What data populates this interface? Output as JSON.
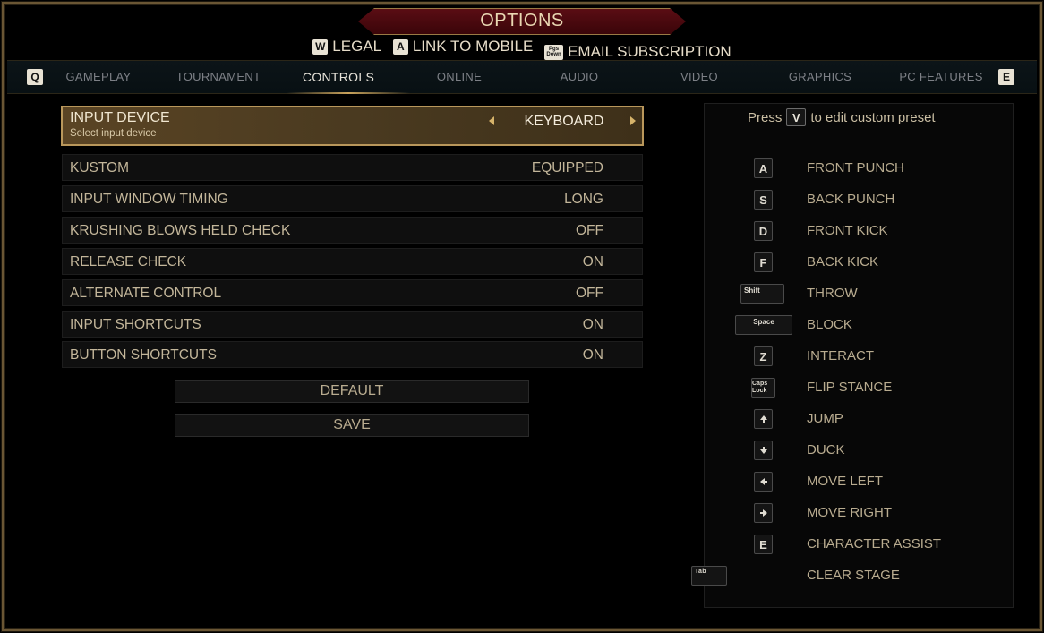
{
  "header": {
    "title": "OPTIONS",
    "subnav": [
      {
        "key": "W",
        "label": "LEGAL"
      },
      {
        "key": "A",
        "label": "LINK TO MOBILE"
      },
      {
        "key_top": "Pgs",
        "key_bottom": "Down",
        "label": "EMAIL SUBSCRIPTION"
      }
    ]
  },
  "tabs": {
    "prev_key": "Q",
    "next_key": "E",
    "items": [
      "GAMEPLAY",
      "TOURNAMENT",
      "CONTROLS",
      "ONLINE",
      "AUDIO",
      "VIDEO",
      "GRAPHICS",
      "PC FEATURES"
    ],
    "active": "CONTROLS"
  },
  "settings": {
    "input_device": {
      "label": "INPUT DEVICE",
      "sublabel": "Select input device",
      "value": "KEYBOARD"
    },
    "rows": [
      {
        "label": "KUSTOM",
        "value": "EQUIPPED"
      },
      {
        "label": "INPUT WINDOW TIMING",
        "value": "LONG"
      },
      {
        "label": "KRUSHING BLOWS HELD CHECK",
        "value": "OFF"
      },
      {
        "label": "RELEASE CHECK",
        "value": "ON"
      },
      {
        "label": "ALTERNATE CONTROL",
        "value": "OFF"
      },
      {
        "label": "INPUT SHORTCUTS",
        "value": "ON"
      },
      {
        "label": "BUTTON SHORTCUTS",
        "value": "ON"
      }
    ],
    "default_label": "DEFAULT",
    "save_label": "SAVE"
  },
  "bindings": {
    "press_prefix": "Press",
    "press_key": "V",
    "press_suffix": "to edit custom preset",
    "items": [
      {
        "key": "A",
        "action": "FRONT PUNCH"
      },
      {
        "key": "S",
        "action": "BACK PUNCH"
      },
      {
        "key": "D",
        "action": "FRONT KICK"
      },
      {
        "key": "F",
        "action": "BACK KICK"
      },
      {
        "key": "Shift",
        "action": "THROW"
      },
      {
        "key": "Space",
        "action": "BLOCK"
      },
      {
        "key": "Z",
        "action": "INTERACT"
      },
      {
        "key": "Caps Lock",
        "action": "FLIP STANCE"
      },
      {
        "key": "up-arrow-icon",
        "action": "JUMP"
      },
      {
        "key": "down-arrow-icon",
        "action": "DUCK"
      },
      {
        "key": "left-arrow-icon",
        "action": "MOVE LEFT"
      },
      {
        "key": "right-arrow-icon",
        "action": "MOVE RIGHT"
      },
      {
        "key": "E",
        "action": "CHARACTER ASSIST"
      },
      {
        "key": "Tab",
        "action": "CLEAR STAGE"
      }
    ]
  },
  "colors": {
    "accent_gold": "#b9975b",
    "title_red": "#5a0d14",
    "text": "#c3b69a"
  }
}
